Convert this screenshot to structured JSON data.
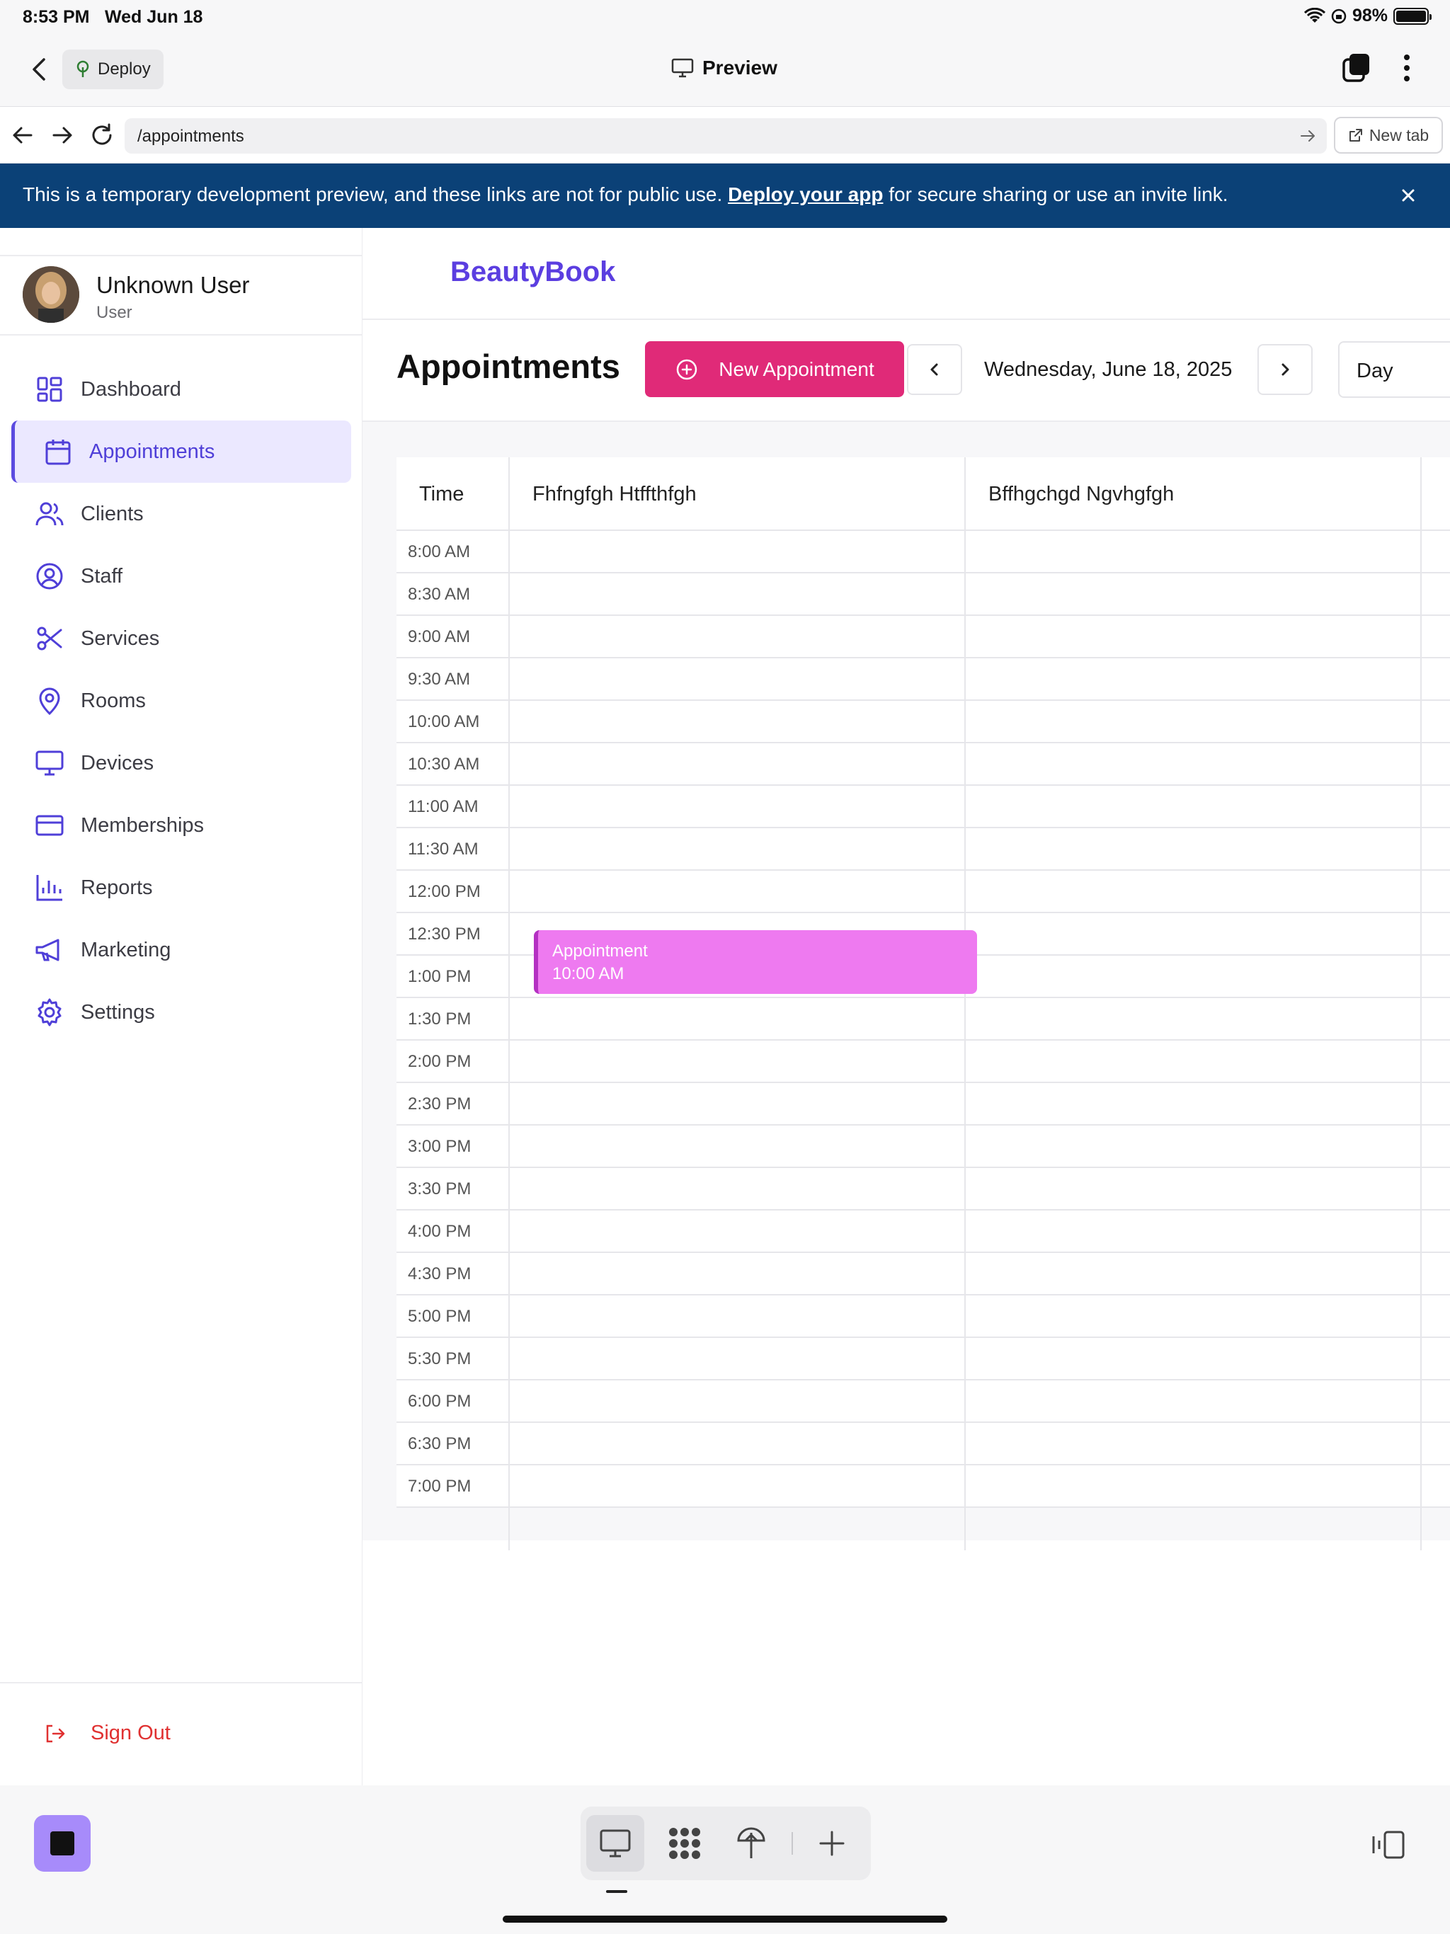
{
  "status": {
    "time": "8:53 PM",
    "date": "Wed Jun 18",
    "battery": "98%"
  },
  "toolbar": {
    "deploy_label": "Deploy",
    "preview_label": "Preview"
  },
  "urlbar": {
    "url": "/appointments",
    "new_tab_label": "New tab"
  },
  "banner": {
    "text_before": "This is a temporary development preview, and these links are not for public use. ",
    "link": "Deploy your app",
    "text_after": " for secure sharing or use an invite link."
  },
  "user": {
    "name": "Unknown User",
    "role": "User"
  },
  "nav": [
    {
      "label": "Dashboard",
      "icon": "dashboard-icon"
    },
    {
      "label": "Appointments",
      "icon": "calendar-icon",
      "active": true
    },
    {
      "label": "Clients",
      "icon": "users-icon"
    },
    {
      "label": "Staff",
      "icon": "user-circle-icon"
    },
    {
      "label": "Services",
      "icon": "scissors-icon"
    },
    {
      "label": "Rooms",
      "icon": "map-pin-icon"
    },
    {
      "label": "Devices",
      "icon": "monitor-icon"
    },
    {
      "label": "Memberships",
      "icon": "credit-card-icon"
    },
    {
      "label": "Reports",
      "icon": "bar-chart-icon"
    },
    {
      "label": "Marketing",
      "icon": "megaphone-icon"
    },
    {
      "label": "Settings",
      "icon": "gear-icon"
    }
  ],
  "signout_label": "Sign Out",
  "brand": "BeautyBook",
  "page": {
    "title": "Appointments",
    "new_button": "New Appointment",
    "date": "Wednesday, June 18, 2025",
    "view": "Day"
  },
  "calendar": {
    "time_header": "Time",
    "staff": [
      "Fhfngfgh Htffthfgh",
      "Bffhgchgd Ngvhgfgh"
    ],
    "times": [
      "8:00 AM",
      "8:30 AM",
      "9:00 AM",
      "9:30 AM",
      "10:00 AM",
      "10:30 AM",
      "11:00 AM",
      "11:30 AM",
      "12:00 PM",
      "12:30 PM",
      "1:00 PM",
      "1:30 PM",
      "2:00 PM",
      "2:30 PM",
      "3:00 PM",
      "3:30 PM",
      "4:00 PM",
      "4:30 PM",
      "5:00 PM",
      "5:30 PM",
      "6:00 PM",
      "6:30 PM",
      "7:00 PM"
    ],
    "appointment": {
      "title": "Appointment",
      "time": "10:00 AM",
      "staff_index": 0,
      "start": "10:00 AM"
    }
  },
  "colors": {
    "accent": "#5b3ee0",
    "new_button": "#e02a78",
    "banner": "#0b4177",
    "appointment": "#ee7af0",
    "signout": "#e03131"
  }
}
